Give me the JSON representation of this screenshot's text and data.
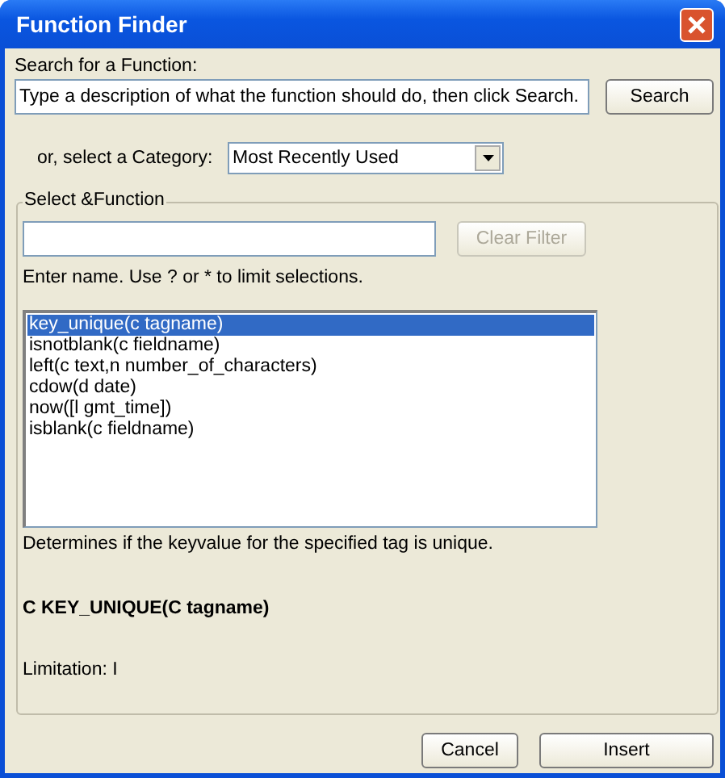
{
  "window": {
    "title": "Function Finder"
  },
  "search": {
    "label": "Search for a Function:",
    "value": "Type a description of what the function should do, then click Search.",
    "button": "Search"
  },
  "category": {
    "label": "or, select a Category:",
    "value": "Most Recently Used"
  },
  "group": {
    "legend": "Select &Function",
    "filter_button": {
      "label": "Clear Filter",
      "disabled": true
    },
    "hint": "Enter name. Use ? or * to limit selections.",
    "functions": [
      {
        "label": "key_unique(c tagname)",
        "selected": true
      },
      {
        "label": "isnotblank(c fieldname)",
        "selected": false
      },
      {
        "label": "left(c text,n number_of_characters)",
        "selected": false
      },
      {
        "label": "cdow(d date)",
        "selected": false
      },
      {
        "label": "now([l gmt_time])",
        "selected": false
      },
      {
        "label": "isblank(c fieldname)",
        "selected": false
      }
    ],
    "description": "Determines if the keyvalue for the specified tag is unique.",
    "signature": "C KEY_UNIQUE(C tagname)",
    "limitation": "Limitation:  I"
  },
  "buttons": [
    "Cancel",
    "Insert"
  ]
}
